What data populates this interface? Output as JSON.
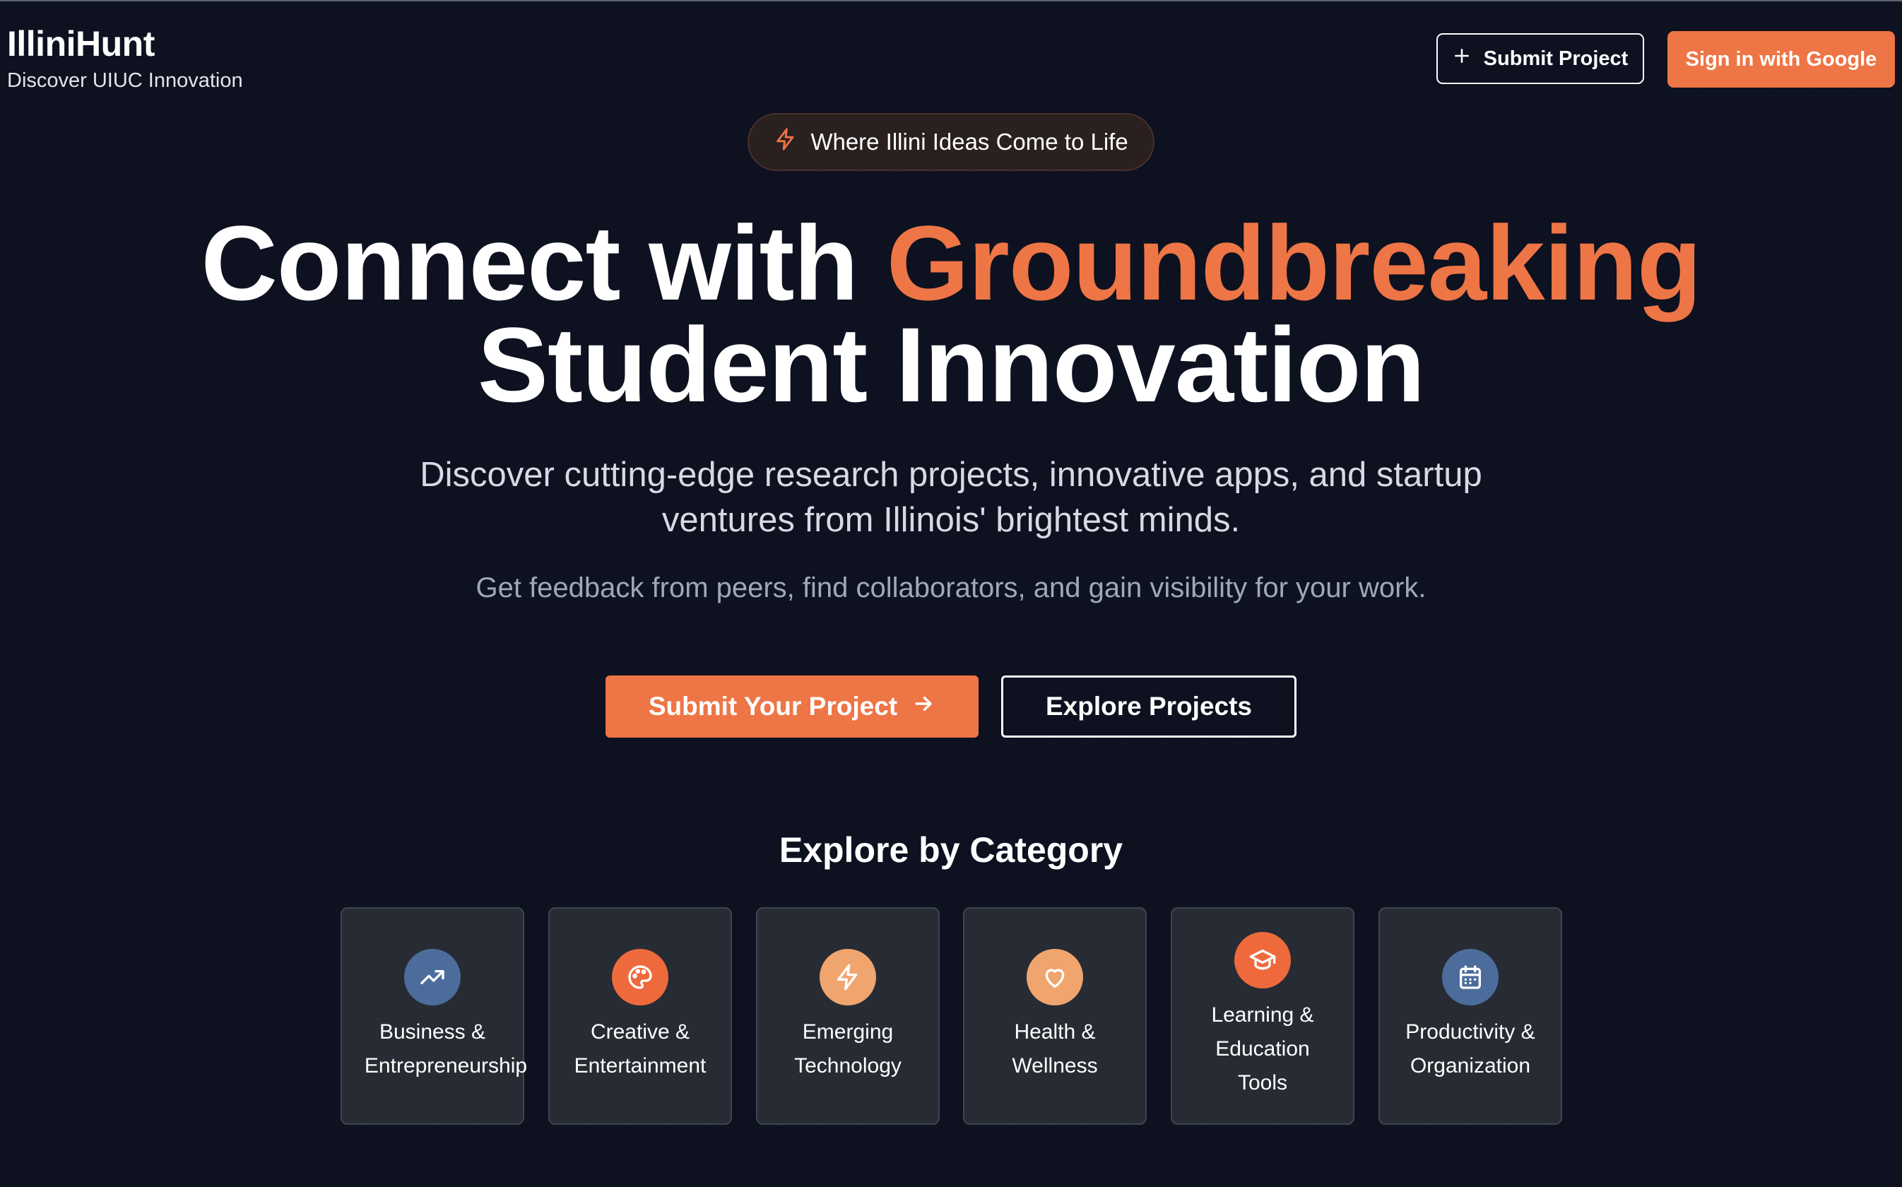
{
  "header": {
    "brand_title": "IlliniHunt",
    "brand_subtitle": "Discover UIUC Innovation",
    "submit_project_label": "Submit Project",
    "sign_in_label": "Sign in with Google"
  },
  "hero": {
    "pill_text": "Where Illini Ideas Come to Life",
    "title_prefix": "Connect with ",
    "title_accent": "Groundbreaking",
    "title_line2": "Student Innovation",
    "lead_line1": "Discover cutting-edge research projects, innovative apps, and startup",
    "lead_line2": "ventures from Illinois' brightest minds.",
    "sublead": "Get feedback from peers, find collaborators, and gain visibility for your work.",
    "primary_cta": "Submit Your Project",
    "secondary_cta": "Explore Projects"
  },
  "categories": {
    "heading": "Explore by Category",
    "items": [
      {
        "lines": [
          "Business &",
          "Entrepreneurship"
        ],
        "icon": "trending-up-icon",
        "color": "#4c6d9c"
      },
      {
        "lines": [
          "Creative &",
          "Entertainment"
        ],
        "icon": "palette-icon",
        "color": "#ee6a3c"
      },
      {
        "lines": [
          "Emerging",
          "Technology"
        ],
        "icon": "zap-icon",
        "color": "#f0a56e"
      },
      {
        "lines": [
          "Health &",
          "Wellness"
        ],
        "icon": "heart-icon",
        "color": "#f0a56e"
      },
      {
        "lines": [
          "Learning &",
          "Education",
          "Tools"
        ],
        "icon": "graduation-cap-icon",
        "color": "#ee6a3c"
      },
      {
        "lines": [
          "Productivity &",
          "Organization"
        ],
        "icon": "calendar-icon",
        "color": "#4c6d9c"
      }
    ]
  },
  "colors": {
    "background": "#0d1120",
    "accent": "#ee7545",
    "card_background": "#272b33"
  }
}
